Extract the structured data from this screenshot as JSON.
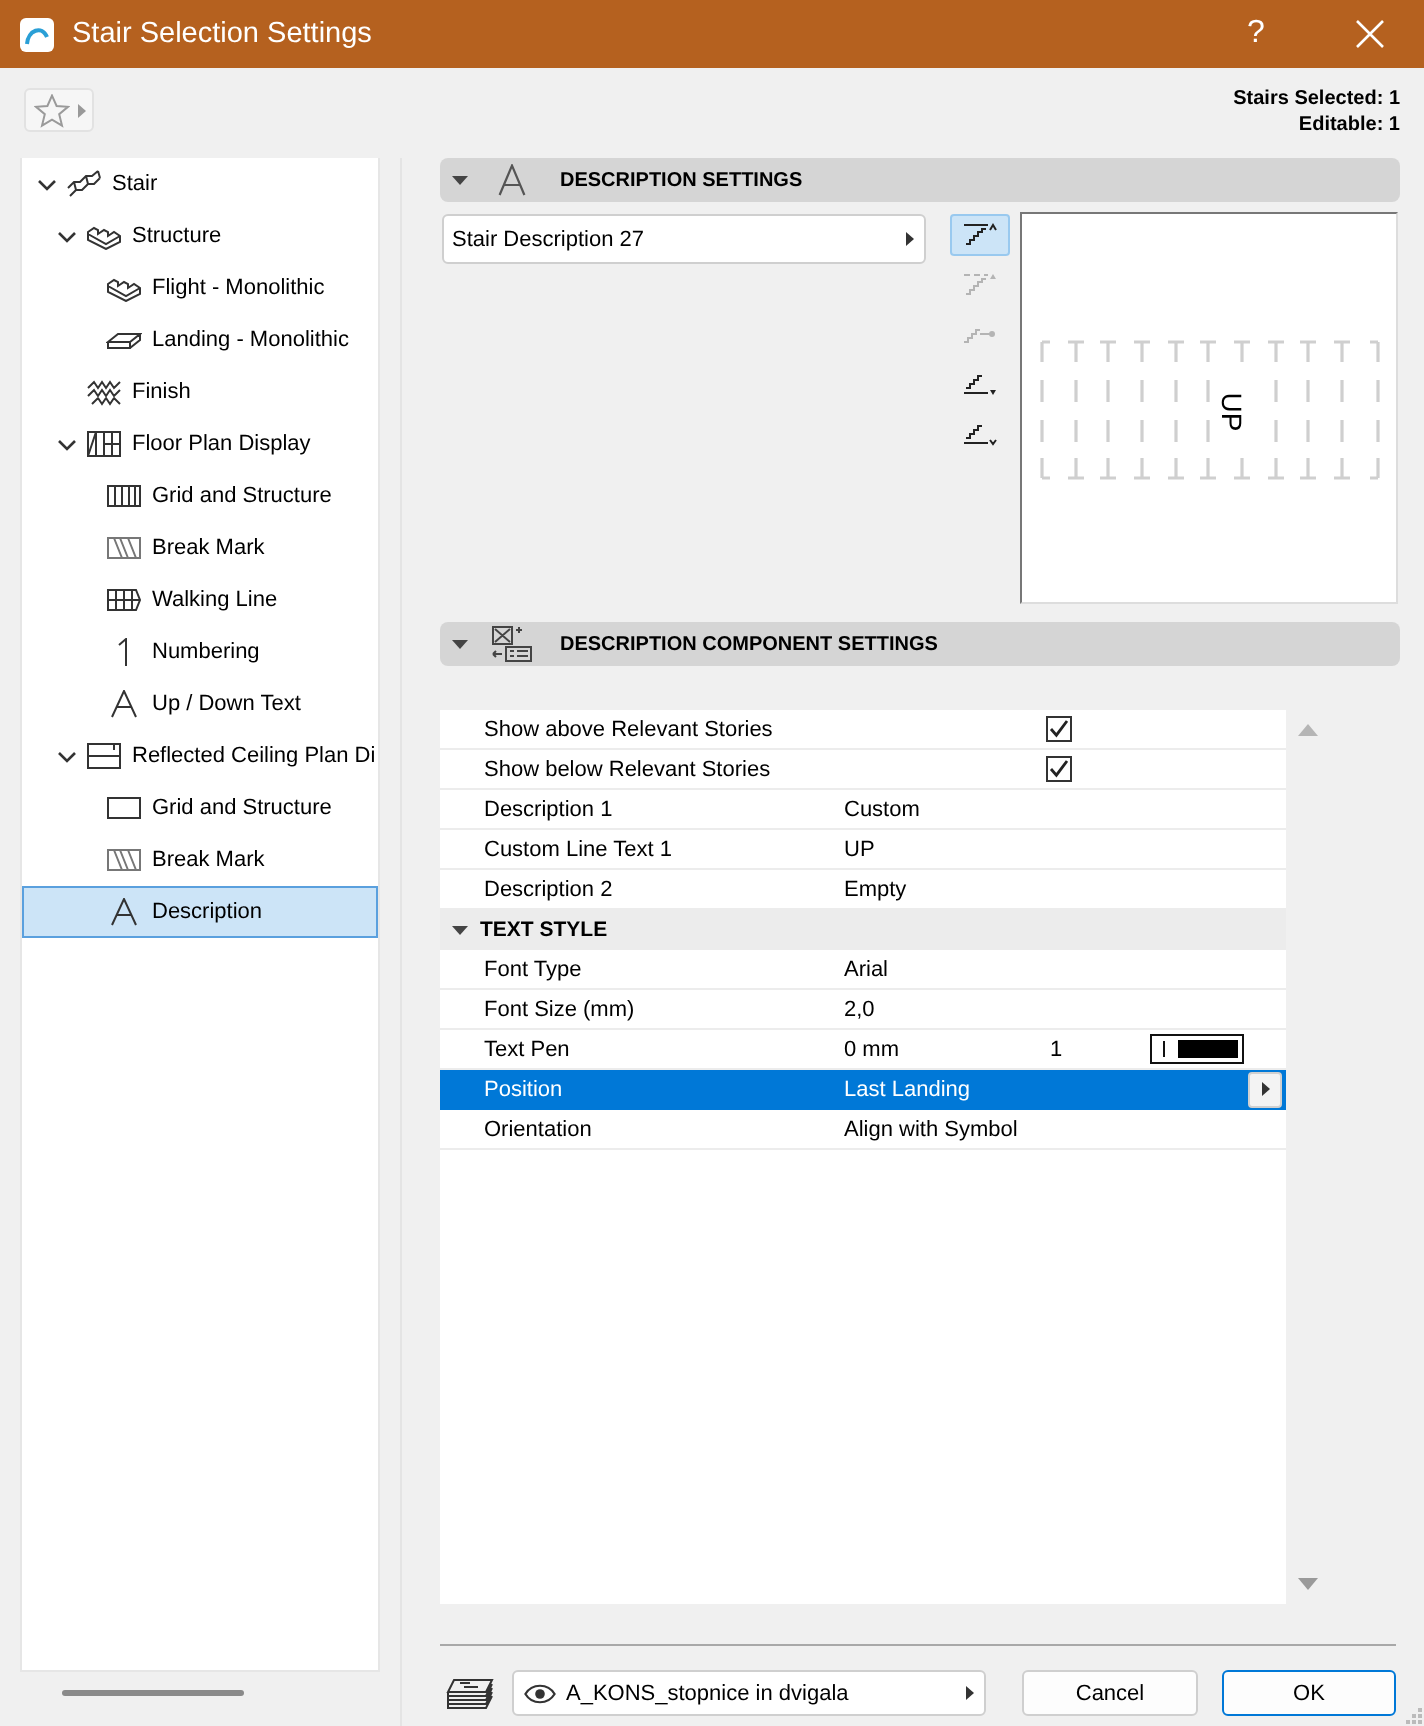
{
  "window": {
    "title": "Stair Selection Settings",
    "help": "?"
  },
  "selection_info": [
    "Stairs Selected: 1",
    "Editable: 1"
  ],
  "tree": [
    {
      "label": "Stair",
      "kind": "stair",
      "expanded": true,
      "selected": false,
      "children": [
        {
          "label": "Structure",
          "kind": "structure",
          "expanded": true,
          "selected": false,
          "children": [
            {
              "label": "Flight - Monolithic",
              "kind": "flight",
              "selected": false
            },
            {
              "label": "Landing - Monolithic",
              "kind": "landing",
              "selected": false
            }
          ]
        },
        {
          "label": "Finish",
          "kind": "finish",
          "selected": false
        },
        {
          "label": "Floor Plan Display",
          "kind": "floorplan",
          "expanded": true,
          "selected": false,
          "children": [
            {
              "label": "Grid and Structure",
              "kind": "grid",
              "selected": false
            },
            {
              "label": "Break Mark",
              "kind": "breakmark",
              "selected": false
            },
            {
              "label": "Walking Line",
              "kind": "walkingline",
              "selected": false
            },
            {
              "label": "Numbering",
              "kind": "numbering",
              "selected": false
            },
            {
              "label": "Up / Down Text",
              "kind": "text",
              "selected": false
            }
          ]
        },
        {
          "label": "Reflected Ceiling Plan Di",
          "kind": "ceiling",
          "expanded": true,
          "selected": false,
          "children": [
            {
              "label": "Grid and Structure",
              "kind": "outline",
              "selected": false
            },
            {
              "label": "Break Mark",
              "kind": "breakmark",
              "selected": false
            },
            {
              "label": "Description",
              "kind": "text",
              "selected": true
            }
          ]
        }
      ]
    }
  ],
  "description_settings": {
    "title": "DESCRIPTION SETTINGS",
    "expanded": true,
    "preset": "Stair Description 27",
    "styles": [
      {
        "kind": "above",
        "selected": true,
        "disabled": false
      },
      {
        "kind": "above-arrow",
        "selected": false,
        "disabled": true
      },
      {
        "kind": "dot",
        "selected": false,
        "disabled": true
      },
      {
        "kind": "below-arrow",
        "selected": false,
        "disabled": false
      },
      {
        "kind": "below",
        "selected": false,
        "disabled": false
      }
    ],
    "preview": {
      "text": "UP"
    }
  },
  "component_settings": {
    "title": "DESCRIPTION COMPONENT SETTINGS",
    "expanded": true,
    "rows": [
      {
        "kind": "check",
        "label": "Show above Relevant Stories",
        "checked": true,
        "selected": false
      },
      {
        "kind": "check",
        "label": "Show below Relevant Stories",
        "checked": true,
        "selected": false
      },
      {
        "kind": "value",
        "label": "Description 1",
        "value": "Custom",
        "selected": false
      },
      {
        "kind": "value",
        "label": "Custom Line Text 1",
        "value": "UP",
        "selected": false
      },
      {
        "kind": "value",
        "label": "Description 2",
        "value": "Empty",
        "selected": false
      },
      {
        "kind": "group",
        "label": "TEXT STYLE",
        "expanded": true,
        "selected": false,
        "rows": [
          {
            "kind": "value",
            "label": "Font Type",
            "value": "Arial",
            "selected": false
          },
          {
            "kind": "value",
            "label": "Font Size (mm)",
            "value": "2,0",
            "selected": false
          },
          {
            "kind": "pen",
            "label": "Text Pen",
            "value": "0 mm",
            "pen": "1",
            "selected": false
          },
          {
            "kind": "value",
            "label": "Position",
            "value": "Last Landing",
            "selected": true
          },
          {
            "kind": "value",
            "label": "Orientation",
            "value": "Align with Symbol",
            "selected": false
          }
        ]
      }
    ]
  },
  "footer": {
    "layer": "A_KONS_stopnice in dvigala",
    "buttons": [
      {
        "label": "Cancel",
        "default": false
      },
      {
        "label": "OK",
        "default": true
      }
    ]
  }
}
